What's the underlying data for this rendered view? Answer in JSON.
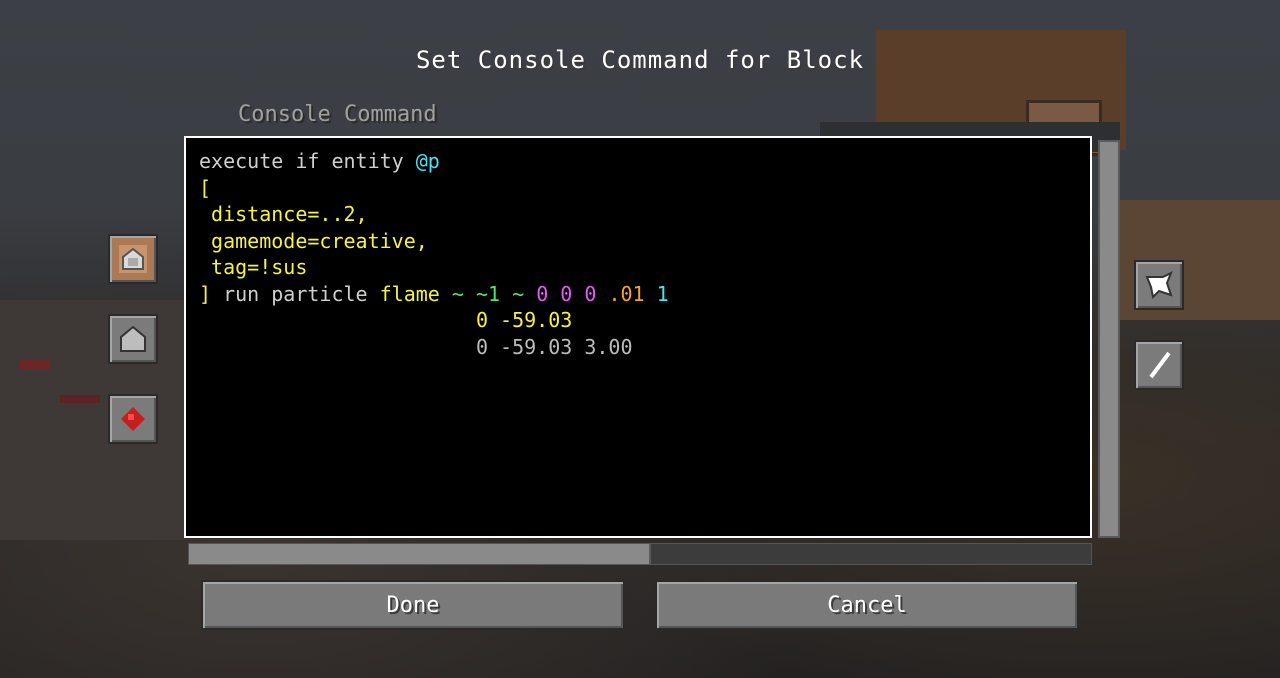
{
  "title": "Set Console Command for Block",
  "label": "Console Command",
  "command_lines": [
    [
      {
        "t": "execute if entity ",
        "c": "w"
      },
      {
        "t": "@p",
        "c": "c"
      }
    ],
    [
      {
        "t": "[",
        "c": "y"
      }
    ],
    [
      {
        "t": " distance=..2,",
        "c": "y"
      }
    ],
    [
      {
        "t": " gamemode=creative,",
        "c": "y"
      }
    ],
    [
      {
        "t": " tag=!sus",
        "c": "y"
      }
    ],
    [
      {
        "t": "] ",
        "c": "y"
      },
      {
        "t": "run particle ",
        "c": "w"
      },
      {
        "t": "flame ",
        "c": "y"
      },
      {
        "t": "~ ~1 ~ ",
        "c": "g"
      },
      {
        "t": "0 0 0 ",
        "c": "m"
      },
      {
        "t": ".01 ",
        "c": "o"
      },
      {
        "t": "1",
        "c": "c"
      }
    ],
    [
      {
        "t": "                       ",
        "c": "w"
      },
      {
        "t": "0 -59.03",
        "c": "y"
      }
    ],
    [
      {
        "t": "                       ",
        "c": "w"
      },
      {
        "t": "0 -59.03 3.00",
        "c": "gr"
      }
    ]
  ],
  "buttons": {
    "done": "Done",
    "cancel": "Cancel"
  },
  "side_buttons": {
    "left": [
      "impulse-block-icon",
      "chain-block-icon",
      "redstone-icon"
    ],
    "right": [
      "conditional-arrow-icon",
      "track-output-icon"
    ]
  },
  "colors": {
    "white": "#cfcfcf",
    "yellow": "#f5f04a",
    "cyan": "#4fe0f0",
    "green": "#55e07a",
    "magenta": "#e25bf0",
    "orange": "#f2a330",
    "gray": "#bcbcbc"
  }
}
